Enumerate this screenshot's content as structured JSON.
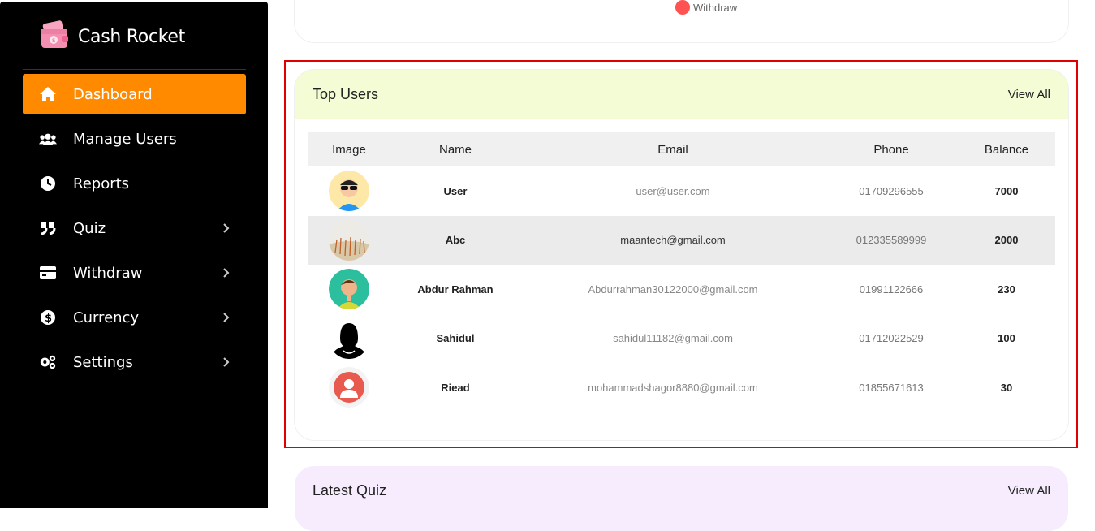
{
  "brand": {
    "name": "Cash Rocket"
  },
  "sidebar": {
    "items": [
      {
        "label": "Dashboard",
        "icon": "home-icon",
        "active": true,
        "has_submenu": false
      },
      {
        "label": "Manage Users",
        "icon": "users-icon",
        "active": false,
        "has_submenu": false
      },
      {
        "label": "Reports",
        "icon": "clock-icon",
        "active": false,
        "has_submenu": false
      },
      {
        "label": "Quiz",
        "icon": "quote-icon",
        "active": false,
        "has_submenu": true
      },
      {
        "label": "Withdraw",
        "icon": "credit-card-icon",
        "active": false,
        "has_submenu": true
      },
      {
        "label": "Currency",
        "icon": "dollar-icon",
        "active": false,
        "has_submenu": true
      },
      {
        "label": "Settings",
        "icon": "gears-icon",
        "active": false,
        "has_submenu": true
      }
    ]
  },
  "chart_legend": {
    "label": "Withdraw",
    "color": "#ff5252"
  },
  "top_users": {
    "title": "Top Users",
    "view_all": "View All",
    "columns": [
      "Image",
      "Name",
      "Email",
      "Phone",
      "Balance"
    ],
    "rows": [
      {
        "avatar": "cartoon-man-sunglasses-avatar",
        "name": "User",
        "email": "user@user.com",
        "phone": "01709296555",
        "balance": "7000"
      },
      {
        "avatar": "wheat-field-photo-avatar",
        "name": "Abc",
        "email": "maantech@gmail.com",
        "phone": "012335589999",
        "balance": "2000"
      },
      {
        "avatar": "cartoon-man-green-avatar",
        "name": "Abdur Rahman",
        "email": "Abdurrahman30122000@gmail.com",
        "phone": "01991122666",
        "balance": "230"
      },
      {
        "avatar": "woman-silhouette-avatar",
        "name": "Sahidul",
        "email": "sahidul11182@gmail.com",
        "phone": "01712022529",
        "balance": "100"
      },
      {
        "avatar": "default-user-avatar",
        "name": "Riead",
        "email": "mohammadshagor8880@gmail.com",
        "phone": "01855671613",
        "balance": "30"
      }
    ]
  },
  "latest_quiz": {
    "title": "Latest Quiz",
    "view_all": "View All"
  },
  "colors": {
    "accent": "#ff8a00",
    "sidebar_bg": "#000000",
    "highlight": "#e00000",
    "users_header_bg": "#f3fcd4",
    "quiz_header_bg": "#f6ecfd"
  }
}
